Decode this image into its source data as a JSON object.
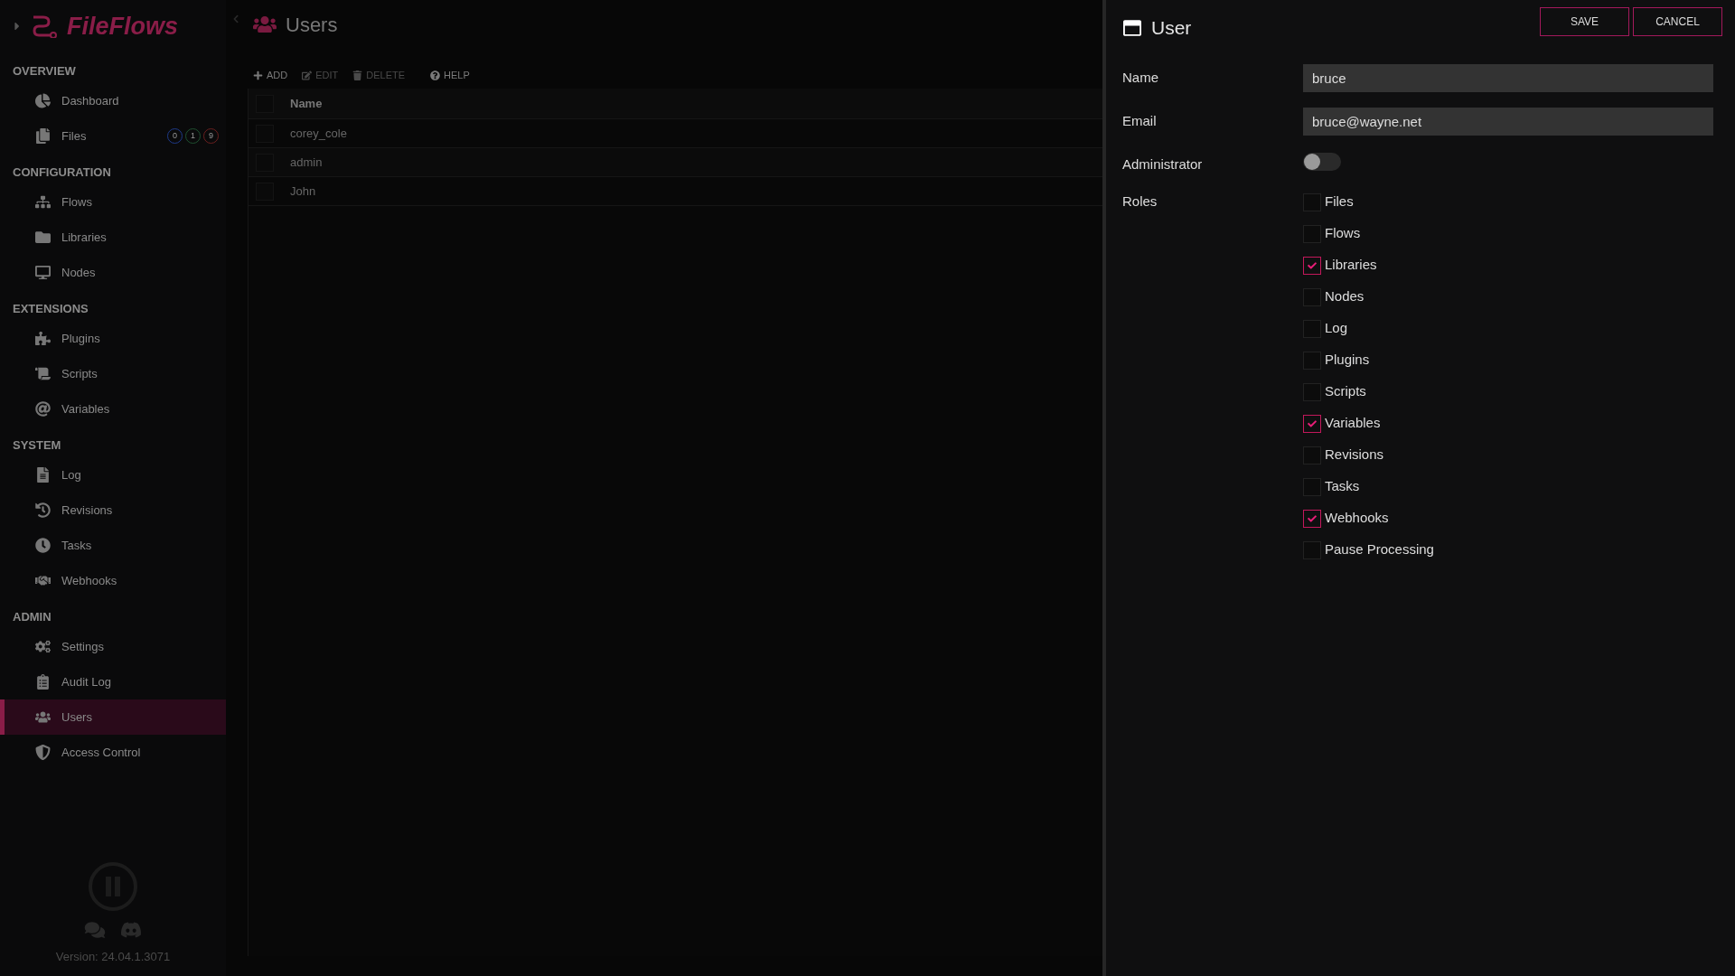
{
  "sidebar": {
    "logo": "FileFlows",
    "sections": [
      {
        "title": "OVERVIEW",
        "items": [
          {
            "label": "Dashboard",
            "selected": false
          },
          {
            "label": "Files",
            "selected": false,
            "badges": [
              {
                "text": "0",
                "color": "#1e3a8a"
              },
              {
                "text": "1",
                "color": "#1f5130"
              },
              {
                "text": "9",
                "color": "#6b1f1f"
              }
            ]
          }
        ]
      },
      {
        "title": "CONFIGURATION",
        "items": [
          {
            "label": "Flows",
            "selected": false
          },
          {
            "label": "Libraries",
            "selected": false
          },
          {
            "label": "Nodes",
            "selected": false
          }
        ]
      },
      {
        "title": "EXTENSIONS",
        "items": [
          {
            "label": "Plugins",
            "selected": false
          },
          {
            "label": "Scripts",
            "selected": false
          },
          {
            "label": "Variables",
            "selected": false
          }
        ]
      },
      {
        "title": "SYSTEM",
        "items": [
          {
            "label": "Log",
            "selected": false
          },
          {
            "label": "Revisions",
            "selected": false
          },
          {
            "label": "Tasks",
            "selected": false
          },
          {
            "label": "Webhooks",
            "selected": false
          }
        ]
      },
      {
        "title": "ADMIN",
        "items": [
          {
            "label": "Settings",
            "selected": false
          },
          {
            "label": "Audit Log",
            "selected": false
          },
          {
            "label": "Users",
            "selected": true
          },
          {
            "label": "Access Control",
            "selected": false
          }
        ]
      }
    ],
    "version": "Version: 24.04.1.3071"
  },
  "main": {
    "title": "Users",
    "toolbar": [
      {
        "label": "ADD",
        "disabled": false
      },
      {
        "label": "EDIT",
        "disabled": true
      },
      {
        "label": "DELETE",
        "disabled": true
      },
      {
        "label": "HELP",
        "disabled": false
      }
    ],
    "table": {
      "select_all": {
        "checked": false
      },
      "columns": [
        "Name"
      ],
      "rows": [
        {
          "name": "corey_cole",
          "selected": false
        },
        {
          "name": "admin",
          "selected": false
        },
        {
          "name": "John",
          "selected": false
        }
      ]
    }
  },
  "panel": {
    "title": "User",
    "buttons": [
      "SAVE",
      "CANCEL"
    ],
    "fields": [
      {
        "label": "Name",
        "value": "bruce"
      },
      {
        "label": "Email",
        "value": "bruce@wayne.net"
      }
    ],
    "administrator": {
      "label": "Administrator",
      "on": false
    },
    "roles": {
      "label": "Roles",
      "options": [
        {
          "label": "Files",
          "checked": false
        },
        {
          "label": "Flows",
          "checked": false
        },
        {
          "label": "Libraries",
          "checked": true
        },
        {
          "label": "Nodes",
          "checked": false
        },
        {
          "label": "Log",
          "checked": false
        },
        {
          "label": "Plugins",
          "checked": false
        },
        {
          "label": "Scripts",
          "checked": false
        },
        {
          "label": "Variables",
          "checked": true
        },
        {
          "label": "Revisions",
          "checked": false
        },
        {
          "label": "Tasks",
          "checked": false
        },
        {
          "label": "Webhooks",
          "checked": true
        },
        {
          "label": "Pause Processing",
          "checked": false
        }
      ]
    }
  }
}
